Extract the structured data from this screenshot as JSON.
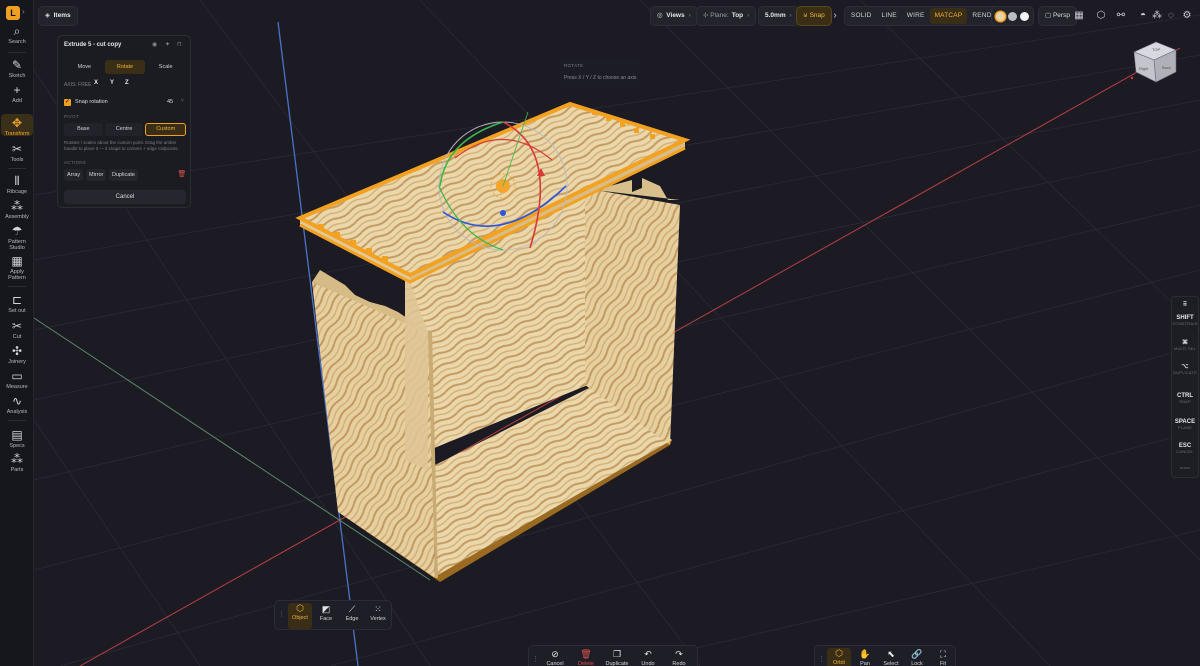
{
  "app": {
    "logo_letter": "L",
    "items_label": "Items"
  },
  "rail": [
    {
      "icon": "search-icon",
      "glyph": "⌕",
      "label": "Search"
    },
    {
      "icon": "sketch-icon",
      "glyph": "✎",
      "label": "Sketch"
    },
    {
      "icon": "add-icon",
      "glyph": "+",
      "label": "Add"
    },
    {
      "icon": "transform-icon",
      "glyph": "✥",
      "label": "Transform"
    },
    {
      "icon": "tools-icon",
      "glyph": "✂",
      "label": "Tools"
    },
    {
      "icon": "ribcage-icon",
      "glyph": "⫴",
      "label": "Ribcage"
    },
    {
      "icon": "assembly-icon",
      "glyph": "⁂",
      "label": "Assembly"
    },
    {
      "icon": "pattern-studio-icon",
      "glyph": "☂",
      "label": "Pattern Studio"
    },
    {
      "icon": "apply-pattern-icon",
      "glyph": "▦",
      "label": "Apply Pattern"
    },
    {
      "icon": "set-out-icon",
      "glyph": "⊏",
      "label": "Set out"
    },
    {
      "icon": "cut-icon",
      "glyph": "✂",
      "label": "Cut"
    },
    {
      "icon": "joinery-icon",
      "glyph": "✣",
      "label": "Joinery"
    },
    {
      "icon": "measure-icon",
      "glyph": "▭",
      "label": "Measure"
    },
    {
      "icon": "analysis-icon",
      "glyph": "∿",
      "label": "Analysis"
    },
    {
      "icon": "specs-icon",
      "glyph": "▤",
      "label": "Specs"
    },
    {
      "icon": "parts-icon",
      "glyph": "⁂",
      "label": "Parts"
    }
  ],
  "topbar": {
    "views_label": "Views",
    "plane_label": "Plane:",
    "plane_value": "Top",
    "step_value": "5.0mm",
    "snap_label": "Snap",
    "modes": [
      "SOLID",
      "LINE",
      "WIRE",
      "MATCAP",
      "RENDER"
    ],
    "active_mode": "MATCAP",
    "persp_label": "Persp",
    "swatch_colors": [
      "#e8d4a8",
      "#bdbdc4",
      "#f2f2f4"
    ]
  },
  "panel": {
    "title": "Extrude 5 - cut copy",
    "tabs": [
      "Move",
      "Rotate",
      "Scale"
    ],
    "active_tab": "Rotate",
    "axis_free_label": "AXIS: FREE",
    "axes": [
      "X",
      "Y",
      "Z"
    ],
    "snap_rotation_label": "Snap rotation",
    "snap_rotation_value": "45",
    "pivot_label": "PIVOT",
    "pivots": [
      "Base",
      "Centre",
      "Custom"
    ],
    "active_pivot": "Custom",
    "hint": "Rotates / scales about the custom point. Drag the amber handle to place it — it snaps to corners + edge midpoints.",
    "actions_label": "ACTIONS",
    "actions": [
      "Array",
      "Mirror",
      "Duplicate"
    ],
    "cancel_label": "Cancel"
  },
  "rotate_hint": {
    "title": "ROTATE",
    "text": "Press X / Y / Z to choose an axis"
  },
  "shortcuts": [
    {
      "key": "⠿",
      "action": ""
    },
    {
      "key": "SHIFT",
      "action": "CONSTRAIN"
    },
    {
      "key": "⌘",
      "action": "MULTI SEL"
    },
    {
      "key": "⌥",
      "action": "DUPLICATE"
    },
    {
      "key": "CTRL",
      "action": "SNAP"
    },
    {
      "key": "SPACE",
      "action": "PLANE"
    },
    {
      "key": "ESC",
      "action": "CANCEL"
    },
    {
      "key": "",
      "action": "more"
    }
  ],
  "select_modes": [
    {
      "icon": "object-icon",
      "glyph": "⬡",
      "label": "Object"
    },
    {
      "icon": "face-icon",
      "glyph": "◩",
      "label": "Face"
    },
    {
      "icon": "edge-icon",
      "glyph": "⟋",
      "label": "Edge"
    },
    {
      "icon": "vertex-icon",
      "glyph": "⁙",
      "label": "Vertex"
    }
  ],
  "active_select_mode": "Object",
  "edit_actions": [
    {
      "icon": "cancel-icon",
      "glyph": "⊘",
      "label": "Cancel"
    },
    {
      "icon": "delete-icon",
      "glyph": "🗑",
      "label": "Delete"
    },
    {
      "icon": "duplicate-icon",
      "glyph": "❐",
      "label": "Duplicate"
    },
    {
      "icon": "undo-icon",
      "glyph": "↶",
      "label": "Undo"
    },
    {
      "icon": "redo-icon",
      "glyph": "↷",
      "label": "Redo"
    }
  ],
  "tool_actions": [
    {
      "icon": "orbit-icon",
      "glyph": "⬡",
      "label": "Orbit"
    },
    {
      "icon": "pan-icon",
      "glyph": "✋",
      "label": "Pan"
    },
    {
      "icon": "select-icon",
      "glyph": "⬉",
      "label": "Select"
    },
    {
      "icon": "lock-icon",
      "glyph": "🔗",
      "label": "Lock"
    },
    {
      "icon": "fit-icon",
      "glyph": "⛶",
      "label": "Fit"
    }
  ],
  "viewcube": {
    "top": "TOP",
    "left": "Right",
    "right": "Back"
  }
}
